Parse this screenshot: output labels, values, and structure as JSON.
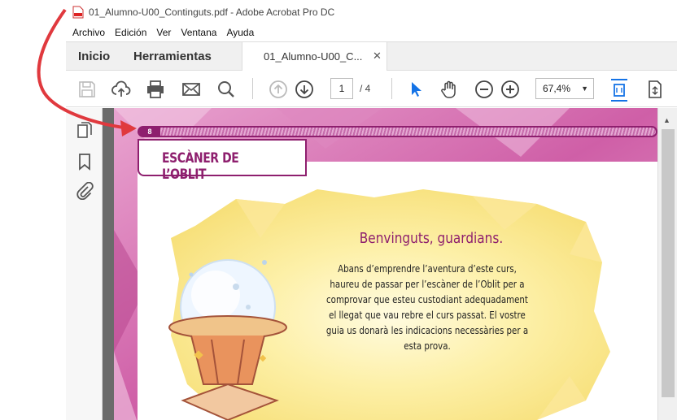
{
  "window": {
    "title": "01_Alumno-U00_Continguts.pdf - Adobe Acrobat Pro DC"
  },
  "menu": {
    "items": [
      "Archivo",
      "Edición",
      "Ver",
      "Ventana",
      "Ayuda"
    ]
  },
  "tabs": {
    "home": "Inicio",
    "tools": "Herramientas",
    "document": "01_Alumno-U00_C...",
    "close": "✕"
  },
  "toolbar": {
    "current_page": "1",
    "total_pages": "/ 4",
    "zoom": "67,4%",
    "icons": [
      "save-icon",
      "upload-icon",
      "print-icon",
      "mail-icon",
      "search-icon",
      "page-up-icon",
      "page-down-icon",
      "select-cursor-icon",
      "hand-icon",
      "zoom-out-icon",
      "zoom-in-icon",
      "fit-page-icon",
      "scroll-mode-icon"
    ]
  },
  "sidebar": {
    "icons": [
      "pages-icon",
      "bookmark-icon",
      "attachment-icon"
    ]
  },
  "document": {
    "page_number": "8",
    "heading": "ESCÀNER DE L’OBLIT",
    "welcome_title": "Benvinguts, guardians.",
    "welcome_text": "Abans d’emprendre l’aventura d’este curs, haureu de passar per l’escàner de l’Oblit per a comprovar que esteu custodiant adequadament el llegat que vau rebre el curs passat. El vostre guia us donarà les indicacions necessàries per a esta prova."
  },
  "colors": {
    "brand": "#8e1f6e",
    "annotation_arrow": "#e0393e",
    "accent_blue": "#1473e6"
  }
}
